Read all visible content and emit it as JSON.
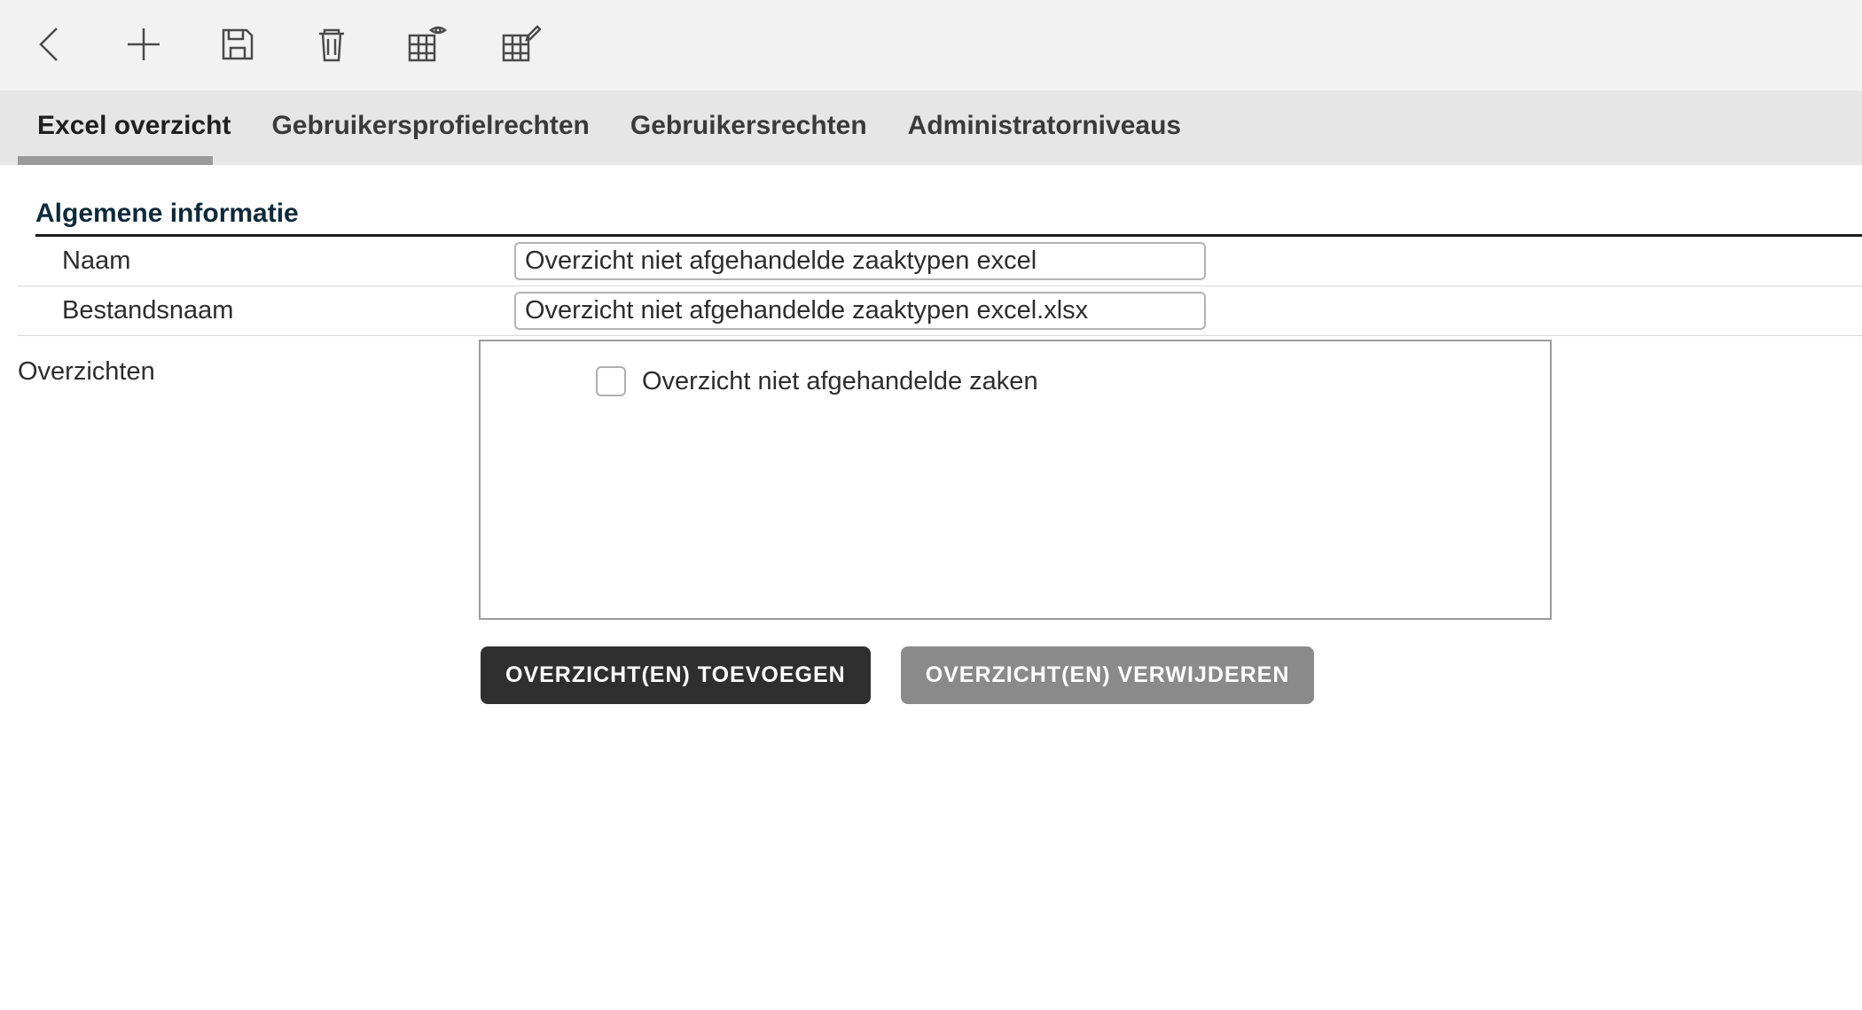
{
  "toolbar": {
    "icons": [
      "back",
      "add",
      "save",
      "delete",
      "table-view",
      "table-edit"
    ]
  },
  "tabs": [
    {
      "label": "Excel overzicht",
      "active": true
    },
    {
      "label": "Gebruikersprofielrechten",
      "active": false
    },
    {
      "label": "Gebruikersrechten",
      "active": false
    },
    {
      "label": "Administratorniveaus",
      "active": false
    }
  ],
  "section": {
    "title": "Algemene informatie"
  },
  "fields": {
    "naam_label": "Naam",
    "naam_value": "Overzicht niet afgehandelde zaaktypen excel",
    "bestandsnaam_label": "Bestandsnaam",
    "bestandsnaam_value": "Overzicht niet afgehandelde zaaktypen excel.xlsx"
  },
  "overzichten": {
    "label": "Overzichten",
    "items": [
      {
        "label": "Overzicht niet afgehandelde zaken",
        "checked": false
      }
    ]
  },
  "buttons": {
    "add": "OVERZICHT(EN) TOEVOEGEN",
    "remove": "OVERZICHT(EN) VERWIJDEREN"
  }
}
